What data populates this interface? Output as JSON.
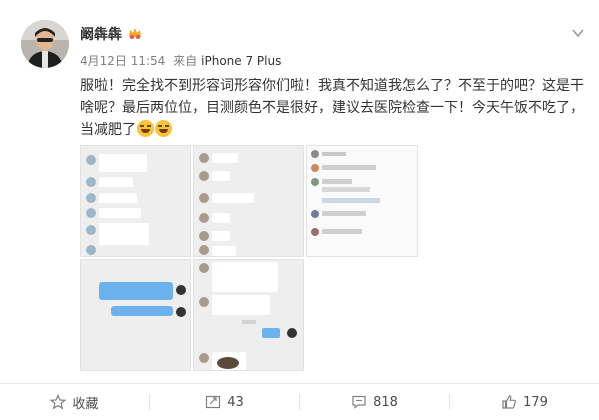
{
  "post": {
    "username": "阚犇犇",
    "date": "4月12日 11:54",
    "source_prefix": "来自",
    "source_name": "iPhone 7 Plus",
    "text": "服啦！完全找不到形容词形容你们啦！我真不知道我怎么了？不至于的吧？这是干啥呢？最后两位位，目测颜色不是很好，建议去医院检查一下！今天午饭不吃了，当减肥了"
  },
  "toolbar": {
    "favorite_label": "收藏",
    "repost_count": "43",
    "comment_count": "818",
    "like_count": "179"
  },
  "colors": {
    "accent": "#ff8200",
    "chat_bubble_self": "#6cb2ef",
    "text_primary": "#333333",
    "text_meta": "#808080"
  }
}
